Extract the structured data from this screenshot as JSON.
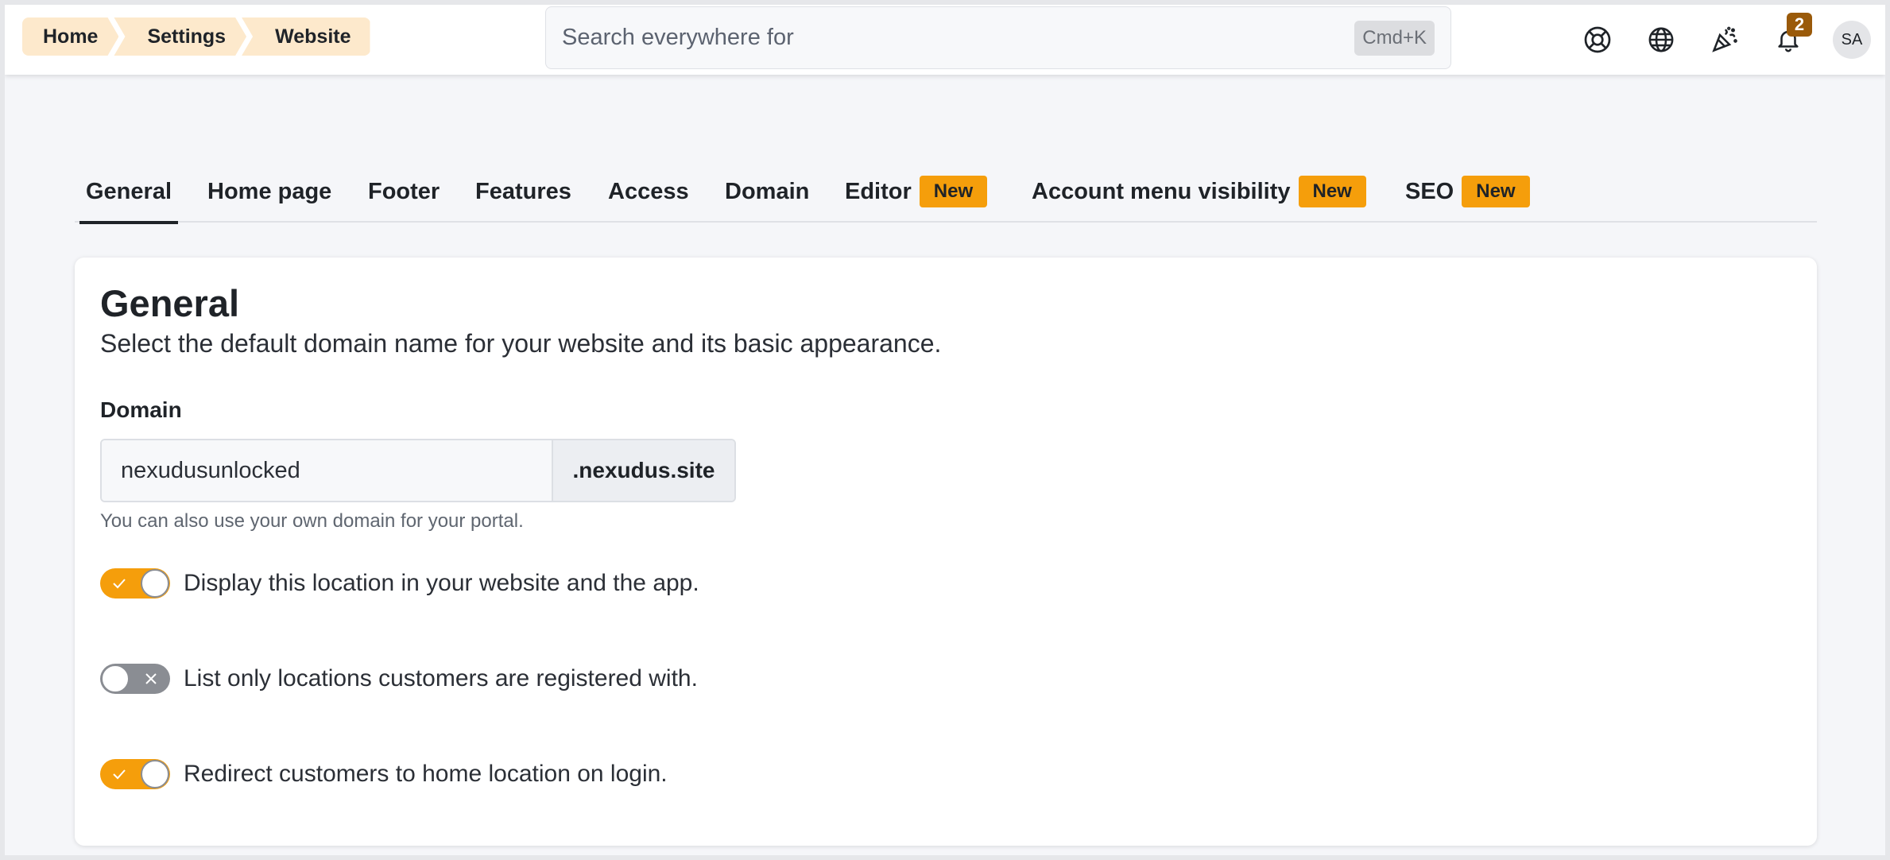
{
  "breadcrumb": [
    {
      "label": "Home"
    },
    {
      "label": "Settings"
    },
    {
      "label": "Website"
    }
  ],
  "search": {
    "placeholder": "Search everywhere for",
    "shortcut": "Cmd+K"
  },
  "header_icons": [
    "help-lifebuoy-icon",
    "globe-icon",
    "party-popper-icon",
    "bell-icon"
  ],
  "notifications": {
    "count": "2"
  },
  "user": {
    "initials": "SA"
  },
  "tabs": [
    {
      "label": "General",
      "active": true
    },
    {
      "label": "Home page"
    },
    {
      "label": "Footer"
    },
    {
      "label": "Features"
    },
    {
      "label": "Access"
    },
    {
      "label": "Domain"
    },
    {
      "label": "Editor",
      "badge": "New"
    },
    {
      "label": "Account menu visibility",
      "badge": "New"
    },
    {
      "label": "SEO",
      "badge": "New"
    }
  ],
  "section": {
    "title": "General",
    "description": "Select the default domain name for your website and its basic appearance."
  },
  "domain": {
    "label": "Domain",
    "value": "nexudusunlocked",
    "suffix": ".nexudus.site",
    "hint": "You can also use your own domain for your portal."
  },
  "toggles": [
    {
      "label": "Display this location in your website and the app.",
      "on": true
    },
    {
      "label": "List only locations customers are registered with.",
      "on": false
    },
    {
      "label": "Redirect customers to home location on login.",
      "on": true
    }
  ],
  "colors": {
    "accent": "#f59e0b",
    "breadcrumb_bg": "#fde9cc",
    "badge_bg": "#9a5a0a",
    "toggle_off": "#8a8d93"
  }
}
